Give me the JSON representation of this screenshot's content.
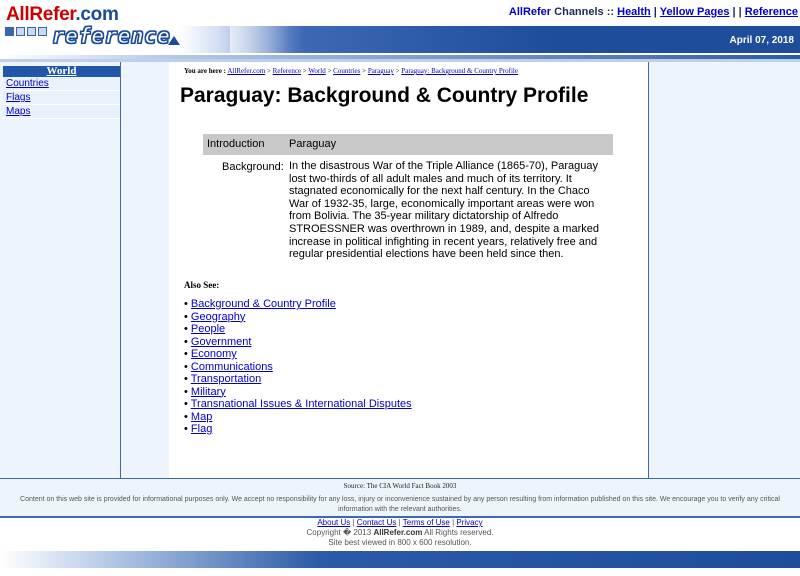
{
  "header": {
    "logo_part1": "AllRefer",
    "logo_part2": ".com",
    "logo_word": "reference",
    "channels_brand": "AllRefer",
    "channels_label": "Channels ::",
    "channel_links": [
      "Health",
      "Yellow Pages",
      "",
      "Reference"
    ],
    "date": "April 07, 2018"
  },
  "sidebar": {
    "title": "World",
    "items": [
      {
        "label": "Countries"
      },
      {
        "label": "Flags"
      },
      {
        "label": "Maps"
      }
    ]
  },
  "breadcrumb": {
    "prefix": "You are here :",
    "items": [
      "AllRefer.com",
      "Reference",
      "World",
      "Countries",
      "Paraguay",
      "Paraguay: Background & Country Profile"
    ],
    "separator": ">"
  },
  "main": {
    "title": "Paraguay: Background & Country Profile",
    "table": {
      "head_col1": "Introduction",
      "head_col2": "Paraguay",
      "bg_label": "Background:",
      "bg_text": "In the disastrous War of the Triple Alliance (1865-70), Paraguay lost two-thirds of all adult males and much of its territory. It stagnated economically for the next half century. In the Chaco War of 1932-35, large, economically important areas were won from Bolivia. The 35-year military dictatorship of Alfredo STROESSNER was overthrown in 1989, and, despite a marked increase in political infighting in recent years, relatively free and regular presidential elections have been held since then."
    },
    "also_see_heading": "Also See:",
    "bullet": "•",
    "also_see": [
      "Background & Country Profile",
      "Geography",
      "People",
      "Government",
      "Economy",
      "Communications",
      "Transportation",
      "Military",
      "Transnational Issues & International Disputes",
      "Map",
      "Flag"
    ]
  },
  "footer": {
    "source": "Source: The CIA World Fact Book 2003",
    "disclaimer": "Content on this web site is provided for informational purposes only. We accept no responsibility for any loss, injury or inconvenience sustained by any person resulting from information published on this site. We encourage you to verify any critical information with the relevant authorities.",
    "links": [
      "About Us",
      "Terms of Use",
      "Privacy"
    ],
    "links_contact": "Contact Us",
    "copyright_prefix": "Copyright � 2013",
    "copyright_brand": "AllRefer.com",
    "copyright_suffix": "All Rights reserved.",
    "best_viewed": "Site best viewed in 800 x 600 resolution."
  },
  "colors": {
    "accent_blue": "#1e4d9b",
    "link": "#0000cc",
    "sidebar_bg": "#eef4fc",
    "table_header_bg": "#c8c8c8",
    "logo_red": "#cc0000"
  }
}
